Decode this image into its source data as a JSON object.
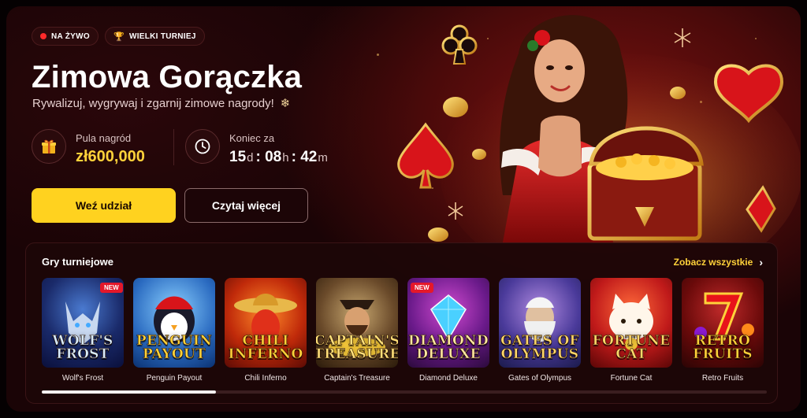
{
  "badges": {
    "live": "NA ŻYWO",
    "tournament": "WIELKI TURNIEJ"
  },
  "hero": {
    "title": "Zimowa Gorączka",
    "subtitle": "Rywalizuj, wygrywaj i zgarnij zimowe nagrody!"
  },
  "stats": {
    "prize_label": "Pula nagród",
    "prize_value": "zł600,000",
    "end_label": "Koniec za",
    "days": "15",
    "days_unit": "d",
    "hours": "08",
    "hours_unit": "h",
    "minutes": "42",
    "minutes_unit": "m"
  },
  "buttons": {
    "join": "Weź udział",
    "read_more": "Czytaj więcej"
  },
  "games": {
    "title": "Gry turniejowe",
    "see_all": "Zobacz wszystkie",
    "new_label": "NEW",
    "scroll_progress": 0.24,
    "items": [
      {
        "name": "Wolf's Frost",
        "logo1": "WOLF'S",
        "logo2": "FROST",
        "new": true
      },
      {
        "name": "Penguin Payout",
        "logo1": "PENGUIN",
        "logo2": "PAYOUT",
        "new": false
      },
      {
        "name": "Chili Inferno",
        "logo1": "CHILI",
        "logo2": "INFERNO",
        "new": false
      },
      {
        "name": "Captain's Treasure",
        "logo1": "CAPTAIN'S",
        "logo2": "TREASURE",
        "new": false
      },
      {
        "name": "Diamond Deluxe",
        "logo1": "DIAMOND",
        "logo2": "DELUXE",
        "new": true
      },
      {
        "name": "Gates of Olympus",
        "logo1": "GATES OF",
        "logo2": "OLYMPUS",
        "new": false
      },
      {
        "name": "Fortune Cat",
        "logo1": "FORTUNE",
        "logo2": "CAT",
        "new": false
      },
      {
        "name": "Retro Fruits",
        "logo1": "RETRO",
        "logo2": "FRUITS",
        "new": false
      }
    ]
  },
  "colors": {
    "accent": "#ffd21f",
    "live_dot": "#ff2a2a",
    "new_tag": "#e5182a"
  }
}
